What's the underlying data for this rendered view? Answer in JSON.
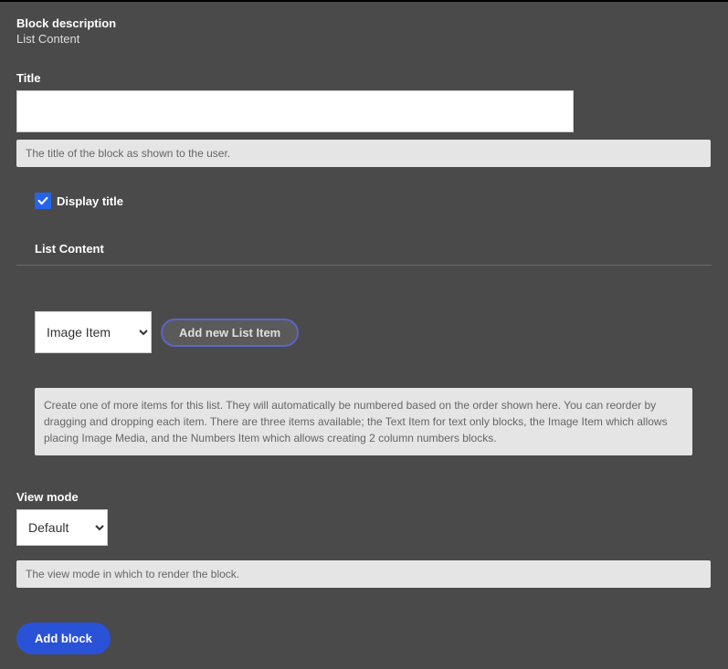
{
  "block_description": {
    "label": "Block description",
    "value": "List Content"
  },
  "title": {
    "label": "Title",
    "value": "",
    "help": "The title of the block as shown to the user."
  },
  "display_title": {
    "checked": true,
    "label": "Display title"
  },
  "list_content": {
    "heading": "List Content",
    "select_value": "Image Item",
    "add_button": "Add new List Item",
    "help": "Create one of more items for this list. They will automatically be numbered based on the order shown here. You can reorder by dragging and dropping each item. There are three items available; the Text Item for text only blocks, the Image Item which allows placing Image Media, and the Numbers Item which allows creating 2 column numbers blocks."
  },
  "view_mode": {
    "label": "View mode",
    "value": "Default",
    "help": "The view mode in which to render the block."
  },
  "add_block_button": "Add block"
}
